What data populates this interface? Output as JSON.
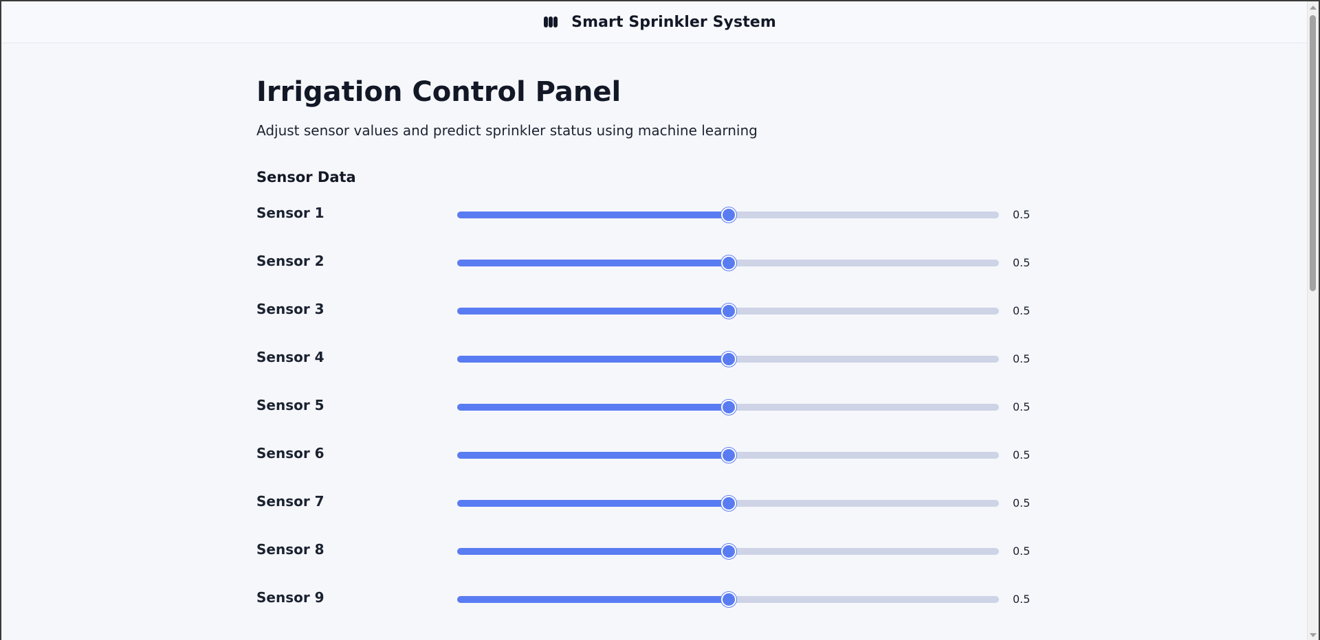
{
  "header": {
    "logo_icon": "sprinkler-logo-icon",
    "title": "Smart Sprinkler System"
  },
  "main": {
    "title": "Irrigation Control Panel",
    "subtitle": "Adjust sensor values and predict sprinkler status using machine learning",
    "section_title": "Sensor Data"
  },
  "sensors": [
    {
      "label": "Sensor 1",
      "value": "0.5",
      "level": 0.5
    },
    {
      "label": "Sensor 2",
      "value": "0.5",
      "level": 0.5
    },
    {
      "label": "Sensor 3",
      "value": "0.5",
      "level": 0.5
    },
    {
      "label": "Sensor 4",
      "value": "0.5",
      "level": 0.5
    },
    {
      "label": "Sensor 5",
      "value": "0.5",
      "level": 0.5
    },
    {
      "label": "Sensor 6",
      "value": "0.5",
      "level": 0.5
    },
    {
      "label": "Sensor 7",
      "value": "0.5",
      "level": 0.5
    },
    {
      "label": "Sensor 8",
      "value": "0.5",
      "level": 0.5
    },
    {
      "label": "Sensor 9",
      "value": "0.5",
      "level": 0.5
    }
  ],
  "colors": {
    "accent": "#5a7cf2",
    "track": "#ced4e6",
    "text": "#121826",
    "background": "#f6f7fb"
  }
}
